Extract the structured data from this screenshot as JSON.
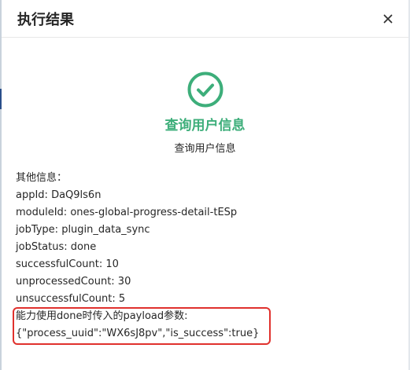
{
  "dialog": {
    "title": "执行结果",
    "close_icon": "close-icon"
  },
  "result": {
    "status_icon": "check-circle-icon",
    "status_color": "#3dae7a",
    "title": "查询用户信息",
    "subtitle": "查询用户信息"
  },
  "info": {
    "heading": "其他信息：",
    "app_id": "appId: DaQ9ls6n",
    "module_id": "moduleId: ones-global-progress-detail-tESp",
    "job_type": "jobType: plugin_data_sync",
    "job_status": "jobStatus: done",
    "successful_count": "successfulCount: 10",
    "unprocessed_count": "unprocessedCount: 30",
    "unsuccessful_count": "unsuccessfulCount: 5",
    "payload_label": "能力使用done时传入的payload参数:",
    "payload_value": "{\"process_uuid\":\"WX6sJ8pv\",\"is_success\":true}"
  },
  "highlight_color": "#e0312d"
}
